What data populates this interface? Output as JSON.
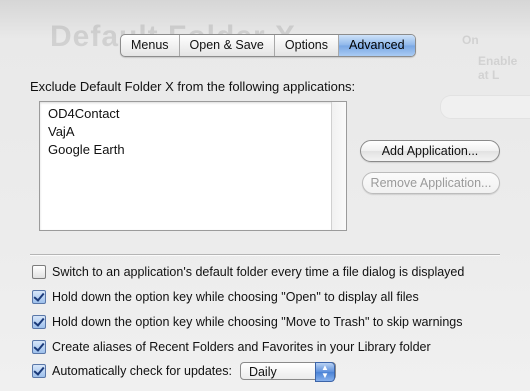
{
  "tabs": [
    "Menus",
    "Open & Save",
    "Options",
    "Advanced"
  ],
  "active_tab": "Advanced",
  "exclude_label": "Exclude Default Folder X from the following applications:",
  "excluded_apps": [
    "OD4Contact",
    "VajA",
    "Google Earth"
  ],
  "buttons": {
    "add": "Add Application...",
    "remove": "Remove Application..."
  },
  "options": [
    {
      "label": "Switch to an application's default folder every time a file dialog is displayed",
      "checked": false
    },
    {
      "label": "Hold down the option key while choosing \"Open\" to display all files",
      "checked": true
    },
    {
      "label": "Hold down the option key while choosing \"Move to Trash\" to skip warnings",
      "checked": true
    },
    {
      "label": "Create aliases of Recent Folders and Favorites in your Library folder",
      "checked": true
    }
  ],
  "update_check": {
    "label": "Automatically check for updates:",
    "checked": true,
    "selected": "Daily"
  },
  "icons": {
    "checkbox": "checkmark-icon",
    "select_arrows": "up-down-arrows-icon"
  },
  "colors": {
    "active_tab": "#8db6ea",
    "check_mark": "#1a3a7a"
  }
}
